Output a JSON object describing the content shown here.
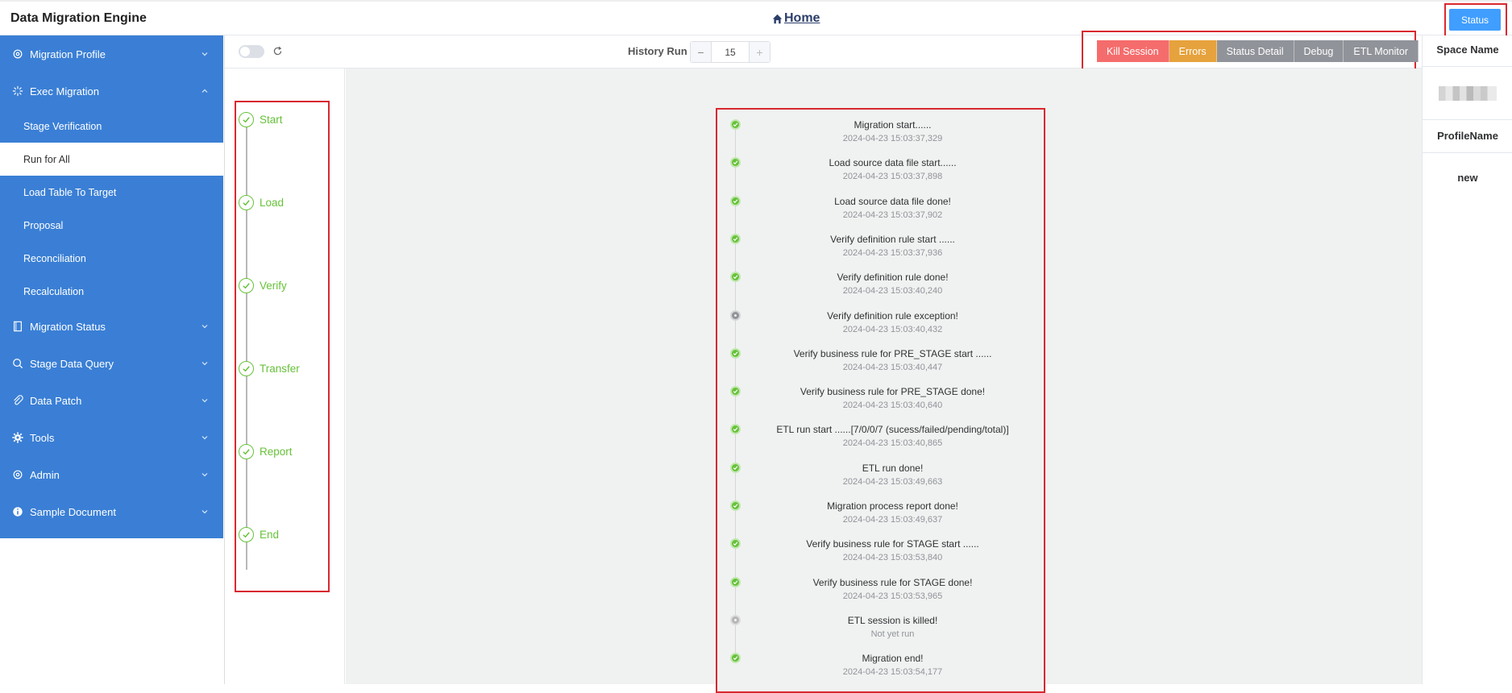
{
  "header": {
    "app_title": "Data Migration Engine",
    "home_label": "Home",
    "status_label": "Status"
  },
  "sidebar": {
    "items": [
      {
        "label": "Migration Profile",
        "icon": "gear-icon",
        "expanded": false
      },
      {
        "label": "Exec Migration",
        "icon": "sparkle-icon",
        "expanded": true,
        "children": [
          "Stage Verification",
          "Run for All",
          "Load Table To Target",
          "Proposal",
          "Reconciliation",
          "Recalculation"
        ],
        "active_child": "Run for All"
      },
      {
        "label": "Migration Status",
        "icon": "document-icon",
        "expanded": false
      },
      {
        "label": "Stage Data Query",
        "icon": "search-icon",
        "expanded": false
      },
      {
        "label": "Data Patch",
        "icon": "paperclip-icon",
        "expanded": false
      },
      {
        "label": "Tools",
        "icon": "cog-icon",
        "expanded": false
      },
      {
        "label": "Admin",
        "icon": "gear-icon",
        "expanded": false
      },
      {
        "label": "Sample Document",
        "icon": "info-icon",
        "expanded": false
      }
    ]
  },
  "toolbar": {
    "history_label": "History Run",
    "history_value": "15",
    "minus": "−",
    "plus": "+",
    "actions": [
      "Kill Session",
      "Errors",
      "Status Detail",
      "Debug",
      "ETL Monitor"
    ]
  },
  "steps": [
    "Start",
    "Load",
    "Verify",
    "Transfer",
    "Report",
    "End"
  ],
  "timeline": [
    {
      "title": "Migration start......",
      "time": "2024-04-23 15:03:37,329",
      "status": "ok"
    },
    {
      "title": "Load source data file start......",
      "time": "2024-04-23 15:03:37,898",
      "status": "ok"
    },
    {
      "title": "Load source data file done!",
      "time": "2024-04-23 15:03:37,902",
      "status": "ok"
    },
    {
      "title": "Verify definition rule start ......",
      "time": "2024-04-23 15:03:37,936",
      "status": "ok"
    },
    {
      "title": "Verify definition rule done!",
      "time": "2024-04-23 15:03:40,240",
      "status": "ok"
    },
    {
      "title": "Verify definition rule exception!",
      "time": "2024-04-23 15:03:40,432",
      "status": "warn"
    },
    {
      "title": "Verify business rule for PRE_STAGE start ......",
      "time": "2024-04-23 15:03:40,447",
      "status": "ok"
    },
    {
      "title": "Verify business rule for PRE_STAGE done!",
      "time": "2024-04-23 15:03:40,640",
      "status": "ok"
    },
    {
      "title": "ETL run start ......[7/0/0/7 (sucess/failed/pending/total)]",
      "time": "2024-04-23 15:03:40,865",
      "status": "ok"
    },
    {
      "title": "ETL run done!",
      "time": "2024-04-23 15:03:49,663",
      "status": "ok"
    },
    {
      "title": "Migration process report done!",
      "time": "2024-04-23 15:03:49,637",
      "status": "ok"
    },
    {
      "title": "Verify business rule for STAGE start ......",
      "time": "2024-04-23 15:03:53,840",
      "status": "ok"
    },
    {
      "title": "Verify business rule for STAGE done!",
      "time": "2024-04-23 15:03:53,965",
      "status": "ok"
    },
    {
      "title": "ETL session is killed!",
      "time": "Not yet run",
      "status": "pending"
    },
    {
      "title": "Migration end!",
      "time": "2024-04-23 15:03:54,177",
      "status": "ok"
    }
  ],
  "right_panel": {
    "space_name_label": "Space Name",
    "profile_name_label": "ProfileName",
    "profile_name_value": "new"
  },
  "colors": {
    "sidebar_bg": "#3a7fd5",
    "success": "#67c23a",
    "danger": "#f56c6c",
    "warning": "#e6a23c",
    "info": "#909399",
    "primary": "#409eff"
  }
}
